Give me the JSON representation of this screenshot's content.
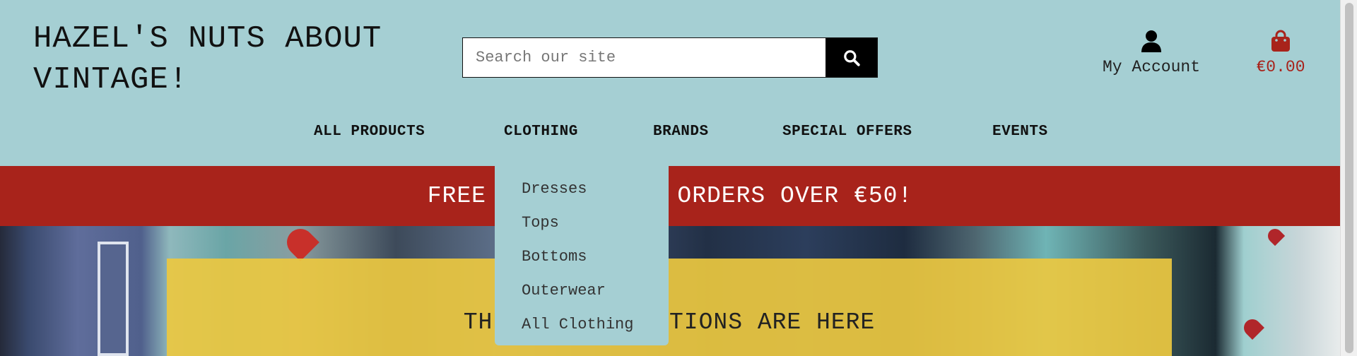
{
  "header": {
    "logo": "HAZEL'S NUTS ABOUT\nVINTAGE!",
    "search": {
      "placeholder": "Search our site",
      "value": "",
      "icon": "search-icon"
    },
    "account": {
      "label": "My Account",
      "icon": "user-icon"
    },
    "cart": {
      "total": "€0.00",
      "icon": "shopping-bag-icon"
    }
  },
  "nav": {
    "items": [
      {
        "label": "ALL PRODUCTS"
      },
      {
        "label": "CLOTHING"
      },
      {
        "label": "BRANDS"
      },
      {
        "label": "SPECIAL OFFERS"
      },
      {
        "label": "EVENTS"
      }
    ],
    "open_menu": "CLOTHING"
  },
  "dropdown": {
    "items": [
      {
        "label": "Dresses"
      },
      {
        "label": "Tops"
      },
      {
        "label": "Bottoms"
      },
      {
        "label": "Outerwear"
      },
      {
        "label": "All Clothing"
      }
    ]
  },
  "banner": {
    "text": "FREE DELIVERY ON ORDERS OVER €50!"
  },
  "hero": {
    "text": "THE NEW COLLECTIONS ARE HERE"
  },
  "colors": {
    "header_bg": "#a5cfd3",
    "banner_bg": "#a8231b",
    "accent_red": "#a8231b",
    "hero_box": "#ecc840",
    "search_button": "#000000"
  }
}
